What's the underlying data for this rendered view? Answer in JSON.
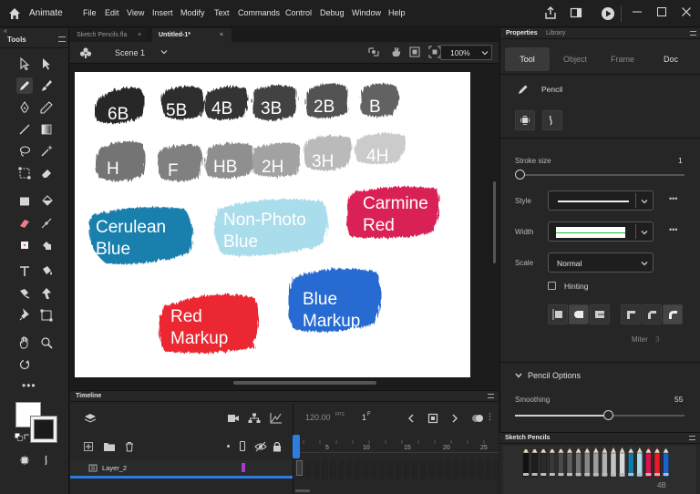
{
  "menubar": {
    "app_name": "Animate",
    "menus": [
      "File",
      "Edit",
      "View",
      "Insert",
      "Modify",
      "Text",
      "Commands",
      "Control",
      "Debug",
      "Window",
      "Help"
    ]
  },
  "tools_panel": {
    "title": "Tools"
  },
  "doc_tabs": [
    {
      "label": "Sketch Pencils.fla",
      "active": false
    },
    {
      "label": "Untitled-1*",
      "active": true
    }
  ],
  "edit_bar": {
    "scene": "Scene 1",
    "zoom": "100%"
  },
  "stage": {
    "swatches": [
      {
        "label": "6B",
        "color": "#1c1c1c",
        "text_color": "#ffffff"
      },
      {
        "label": "5B",
        "color": "#232323",
        "text_color": "#ffffff"
      },
      {
        "label": "4B",
        "color": "#2a2a2a",
        "text_color": "#ffffff"
      },
      {
        "label": "3B",
        "color": "#383838",
        "text_color": "#ffffff"
      },
      {
        "label": "2B",
        "color": "#494949",
        "text_color": "#ffffff"
      },
      {
        "label": "B",
        "color": "#5a5a5a",
        "text_color": "#ffffff"
      },
      {
        "label": "H",
        "color": "#6d6d6d",
        "text_color": "#ffffff"
      },
      {
        "label": "F",
        "color": "#7a7a7a",
        "text_color": "#ffffff"
      },
      {
        "label": "HB",
        "color": "#8a8a8a",
        "text_color": "#ffffff"
      },
      {
        "label": "2H",
        "color": "#9e9e9e",
        "text_color": "#ffffff"
      },
      {
        "label": "3H",
        "color": "#b7b7b7",
        "text_color": "#ffffff"
      },
      {
        "label": "4H",
        "color": "#c9c9c9",
        "text_color": "#ffffff"
      },
      {
        "label": "Cerulean Blue",
        "line1": "Cerulean",
        "line2": "Blue",
        "color": "#1179a8",
        "text_color": "#ffffff"
      },
      {
        "label": "Non-Photo Blue",
        "line1": "Non-Photo",
        "line2": "Blue",
        "color": "#a6dcec",
        "text_color": "#ffffff"
      },
      {
        "label": "Carmine Red",
        "line1": "Carmine",
        "line2": "Red",
        "color": "#d8144e",
        "text_color": "#ffffff"
      },
      {
        "label": "Red Markup",
        "line1": "Red",
        "line2": "Markup",
        "color": "#ea1a26",
        "text_color": "#ffffff"
      },
      {
        "label": "Blue Markup",
        "line1": "Blue",
        "line2": "Markup",
        "color": "#1a63cf",
        "text_color": "#ffffff"
      }
    ]
  },
  "timeline": {
    "title": "Timeline",
    "fps": "120.00",
    "fps_unit": "FPS",
    "frame": "1",
    "frame_unit": "F",
    "ruler": [
      "5",
      "10",
      "15",
      "20",
      "25"
    ],
    "layer_name": "Layer_2",
    "layer_color": "#a43ccc"
  },
  "properties": {
    "tabs": [
      "Properties",
      "Library"
    ],
    "segments": [
      "Tool",
      "Object",
      "Frame",
      "Doc"
    ],
    "tool_name": "Pencil",
    "stroke_size_label": "Stroke size",
    "stroke_size_value": "1",
    "style_label": "Style",
    "width_label": "Width",
    "scale_label": "Scale",
    "scale_value": "Normal",
    "hinting_label": "Hinting",
    "miter_label": "Miter",
    "miter_value": "3",
    "pencil_options_label": "Pencil Options",
    "smoothing_label": "Smoothing",
    "smoothing_value": "55",
    "smoothing_fraction": 0.55
  },
  "sketch_pencils": {
    "title": "Sketch Pencils",
    "selected_label": "4B",
    "pencil_colors": [
      "#111111",
      "#1d1d1d",
      "#2a2a2a",
      "#383838",
      "#4a4a4a",
      "#5e5e5e",
      "#727272",
      "#888888",
      "#9c9c9c",
      "#b0b0b0",
      "#c4c4c4",
      "#d8d8d8",
      "#1179a8",
      "#a6dcec",
      "#d8144e",
      "#ea1a26",
      "#1a63cf"
    ]
  },
  "colors": {
    "accent": "#2d7ddf",
    "stroke_swatch": "#ffffff",
    "fill_swatch": "#1a1a1a"
  }
}
